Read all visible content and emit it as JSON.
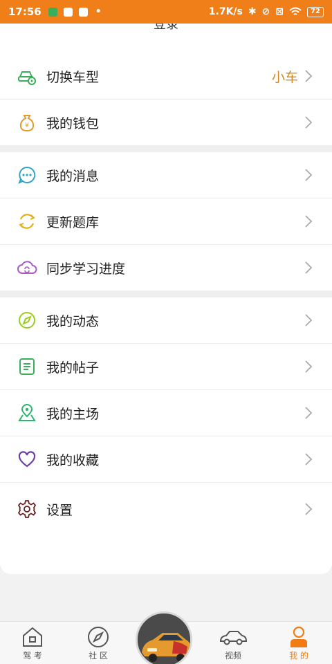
{
  "statusbar": {
    "time": "17:56",
    "network_speed": "1.7K/s",
    "battery": "72"
  },
  "header": {
    "login_label": "登录"
  },
  "menu": {
    "switch_vehicle": {
      "label": "切换车型",
      "value": "小车"
    },
    "wallet": {
      "label": "我的钱包"
    },
    "messages": {
      "label": "我的消息"
    },
    "update_bank": {
      "label": "更新题库"
    },
    "sync_progress": {
      "label": "同步学习进度"
    },
    "posts_feed": {
      "label": "我的动态"
    },
    "threads": {
      "label": "我的帖子"
    },
    "home_field": {
      "label": "我的主场"
    },
    "favorites": {
      "label": "我的收藏"
    },
    "settings": {
      "label": "设置"
    }
  },
  "tabbar": {
    "exam": "驾 考",
    "community": "社 区",
    "video": "视频",
    "mine": "我 的"
  },
  "colors": {
    "accent": "#f07f19",
    "green": "#3aae5a",
    "blue": "#2fa3c8",
    "gold": "#e0b21c",
    "purple": "#a65cc0",
    "lime": "#9ccc1a",
    "teal": "#2bb56f",
    "violet": "#6b3fa8",
    "maroon": "#6b1f1f"
  }
}
